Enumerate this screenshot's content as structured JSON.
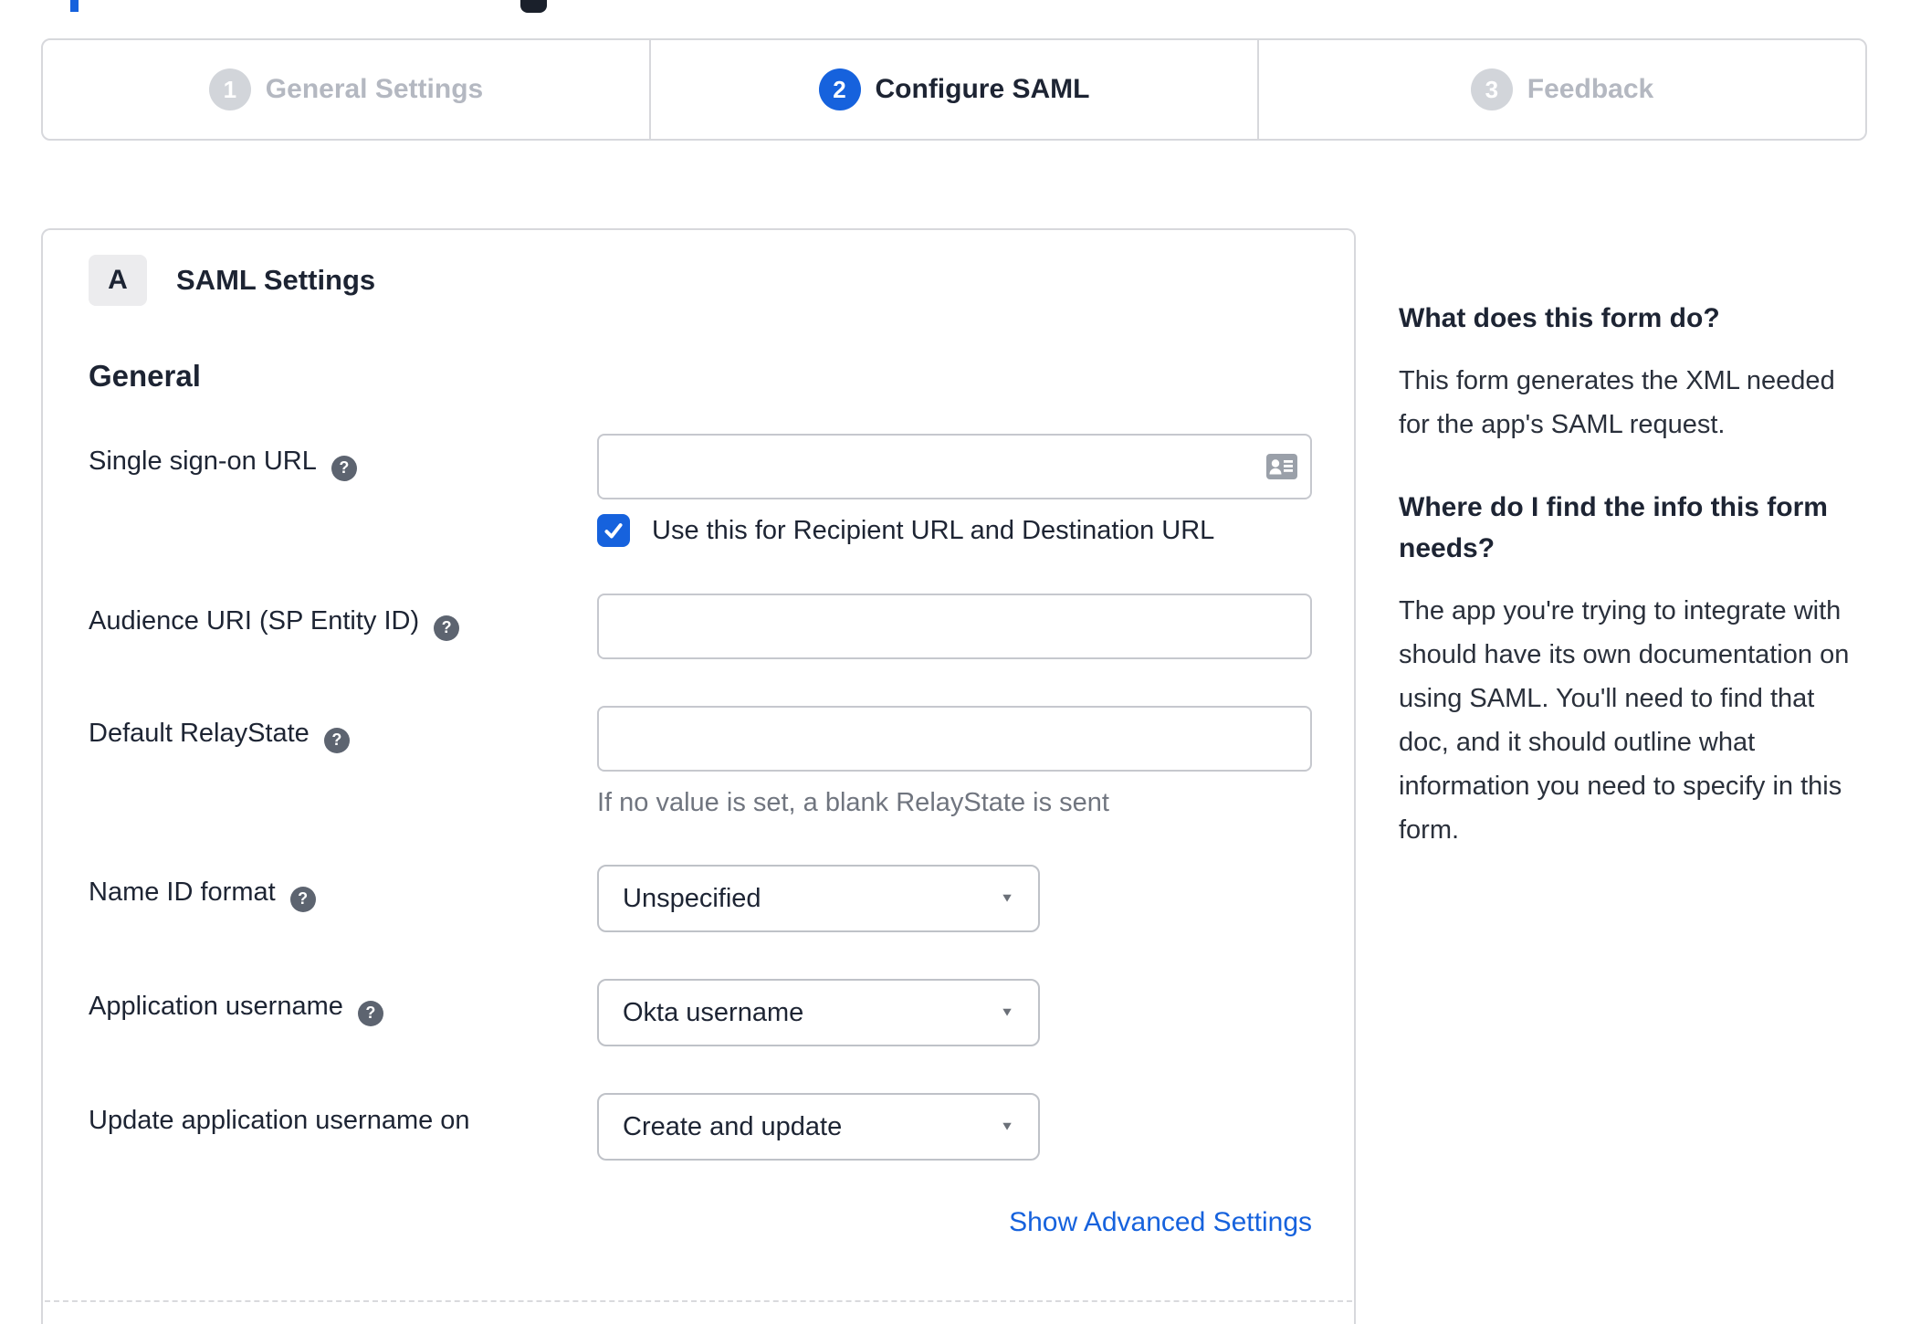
{
  "page": {
    "accent_color": "#1662dd",
    "dark_text_color": "#1d2433",
    "inactive_gray_color": "#b4b8c1",
    "border_color": "#d7d8dc"
  },
  "clipped_fragments": {
    "blue_fragment_color": "#1662dd",
    "dark_fragment_color": "#1a202b"
  },
  "stepper": {
    "steps": [
      {
        "number": "1",
        "label": "General Settings",
        "state": "inactive"
      },
      {
        "number": "2",
        "label": "Configure SAML",
        "state": "active"
      },
      {
        "number": "3",
        "label": "Feedback",
        "state": "inactive"
      }
    ]
  },
  "panel": {
    "badge": "A",
    "title": "SAML Settings",
    "section_heading": "General",
    "rows": [
      {
        "label": "Single sign-on URL",
        "has_help": true,
        "type": "text",
        "value": "",
        "icon": "contact-card-icon"
      },
      {
        "label": "Audience URI (SP Entity ID)",
        "has_help": true,
        "type": "text",
        "value": ""
      },
      {
        "label": "Default RelayState",
        "has_help": true,
        "type": "text",
        "value": ""
      },
      {
        "label": "Name ID format",
        "has_help": true,
        "type": "select",
        "value": "Unspecified"
      },
      {
        "label": "Application username",
        "has_help": true,
        "type": "select",
        "value": "Okta username"
      },
      {
        "label": "Update application username on",
        "has_help": false,
        "type": "select",
        "value": "Create and update"
      }
    ],
    "sso_checkbox": {
      "checked": true,
      "label": "Use this for Recipient URL and Destination URL"
    },
    "relaystate_hint": "If no value is set, a blank RelayState is sent",
    "advanced_link": "Show Advanced Settings"
  },
  "sidebar": {
    "sections": [
      {
        "heading": "What does this form do?",
        "lines": [
          "This form generates the XML needed",
          "for the app's SAML request."
        ]
      },
      {
        "heading": "Where do I find the info this form needs?",
        "lines": [
          "The app you're trying to integrate with",
          "should have its own documentation on",
          "using SAML. You'll need to find that",
          "doc, and it should outline what",
          "information you need to specify in this",
          "form."
        ]
      }
    ]
  }
}
